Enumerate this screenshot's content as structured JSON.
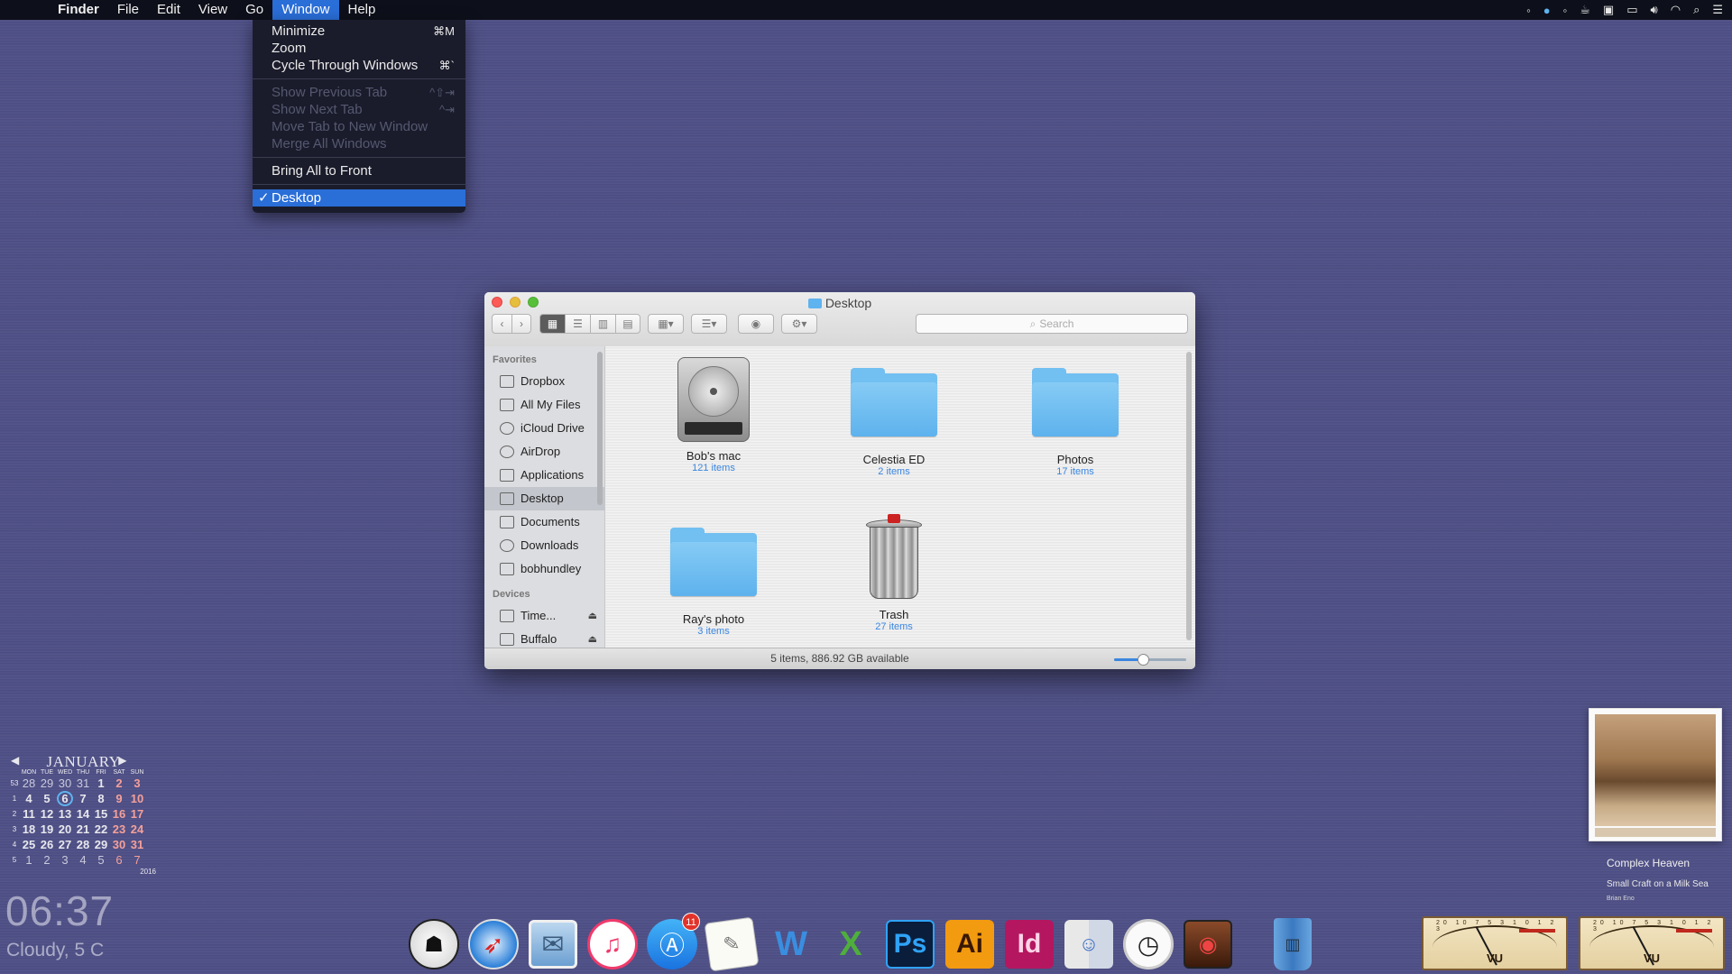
{
  "menubar": {
    "app_name": "Finder",
    "menus": [
      "File",
      "Edit",
      "View",
      "Go",
      "Window",
      "Help"
    ],
    "active_menu": "Window",
    "status_icons": [
      "dropbox-icon",
      "status-dot-icon",
      "menu-extra-icon",
      "coffee-icon",
      "terminal-icon",
      "airplay-icon",
      "volume-icon",
      "wifi-icon",
      "spotlight-icon",
      "notification-center-icon"
    ]
  },
  "window_menu": {
    "items": [
      {
        "label": "Minimize",
        "shortcut": "⌘M",
        "disabled": false
      },
      {
        "label": "Zoom",
        "shortcut": "",
        "disabled": false
      },
      {
        "label": "Cycle Through Windows",
        "shortcut": "⌘`",
        "disabled": false
      },
      {
        "label": "Show Previous Tab",
        "shortcut": "^⇧⇥",
        "disabled": true
      },
      {
        "label": "Show Next Tab",
        "shortcut": "^⇥",
        "disabled": true
      },
      {
        "label": "Move Tab to New Window",
        "shortcut": "",
        "disabled": true
      },
      {
        "label": "Merge All Windows",
        "shortcut": "",
        "disabled": true
      },
      {
        "label": "Bring All to Front",
        "shortcut": "",
        "disabled": false
      },
      {
        "label": "Desktop",
        "shortcut": "",
        "disabled": false,
        "checked": true
      }
    ]
  },
  "finder": {
    "title": "Desktop",
    "search_placeholder": "Search",
    "sidebar": {
      "favorites_header": "Favorites",
      "favorites": [
        {
          "label": "Dropbox",
          "icon": "folder-icon"
        },
        {
          "label": "All My Files",
          "icon": "all-files-icon"
        },
        {
          "label": "iCloud Drive",
          "icon": "cloud-icon"
        },
        {
          "label": "AirDrop",
          "icon": "airdrop-icon"
        },
        {
          "label": "Applications",
          "icon": "applications-icon"
        },
        {
          "label": "Desktop",
          "icon": "desktop-icon",
          "selected": true
        },
        {
          "label": "Documents",
          "icon": "documents-icon"
        },
        {
          "label": "Downloads",
          "icon": "downloads-icon"
        },
        {
          "label": "bobhundley",
          "icon": "home-icon"
        }
      ],
      "devices_header": "Devices",
      "devices": [
        {
          "label": "Time...",
          "icon": "disk-icon"
        },
        {
          "label": "Buffalo",
          "icon": "disk-icon"
        }
      ]
    },
    "items": [
      {
        "name": "Bob's mac",
        "count": "121 items",
        "kind": "hard-drive-icon"
      },
      {
        "name": "Celestia ED",
        "count": "2 items",
        "kind": "folder-icon"
      },
      {
        "name": "Photos",
        "count": "17 items",
        "kind": "folder-icon"
      },
      {
        "name": "Ray's photo",
        "count": "3 items",
        "kind": "folder-icon"
      },
      {
        "name": "Trash",
        "count": "27 items",
        "kind": "trash-icon"
      }
    ],
    "status_text": "5 items, 886.92 GB available",
    "icon_size_fraction": 0.4
  },
  "calendar": {
    "month": "JANUARY",
    "year": "2016",
    "days_of_week": [
      "MON",
      "TUE",
      "WED",
      "THU",
      "FRI",
      "SAT",
      "SUN"
    ],
    "weeks": [
      {
        "wn": "53",
        "days": [
          "28",
          "29",
          "30",
          "31",
          "1",
          "2",
          "3"
        ]
      },
      {
        "wn": "1",
        "days": [
          "4",
          "5",
          "6",
          "7",
          "8",
          "9",
          "10"
        ]
      },
      {
        "wn": "2",
        "days": [
          "11",
          "12",
          "13",
          "14",
          "15",
          "16",
          "17"
        ]
      },
      {
        "wn": "3",
        "days": [
          "18",
          "19",
          "20",
          "21",
          "22",
          "23",
          "24"
        ]
      },
      {
        "wn": "4",
        "days": [
          "25",
          "26",
          "27",
          "28",
          "29",
          "30",
          "31"
        ]
      },
      {
        "wn": "5",
        "days": [
          "1",
          "2",
          "3",
          "4",
          "5",
          "6",
          "7"
        ]
      }
    ],
    "today": "6"
  },
  "clock": {
    "time": "06:37",
    "weather": "Cloudy, 5 C"
  },
  "now_playing": {
    "track": "Complex Heaven",
    "album": "Small Craft on a Milk Sea",
    "artist": "Brian Eno"
  },
  "vu_meters": [
    {
      "label": "VU",
      "scale": "20 10 7 5 3 1 0 1 2 3"
    },
    {
      "label": "VU",
      "scale": "20 10 7 5 3 1 0 1 2 3"
    }
  ],
  "dock": {
    "apps": [
      {
        "name": "stormtrooper-icon",
        "running": true
      },
      {
        "name": "safari-icon",
        "running": true
      },
      {
        "name": "mail-icon",
        "running": true
      },
      {
        "name": "itunes-icon",
        "running": true
      },
      {
        "name": "app-store-icon",
        "badge": "11",
        "running": false
      },
      {
        "name": "textedit-icon",
        "running": false
      },
      {
        "name": "word-icon",
        "running": false
      },
      {
        "name": "scrivener-icon",
        "running": false
      },
      {
        "name": "photoshop-icon",
        "text": "Ps",
        "running": false
      },
      {
        "name": "illustrator-icon",
        "text": "Ai",
        "running": false
      },
      {
        "name": "indesign-icon",
        "text": "Id",
        "running": false
      },
      {
        "name": "finder-icon",
        "running": false
      },
      {
        "name": "clock-icon",
        "running": true
      },
      {
        "name": "radio-icon",
        "running": true
      },
      {
        "name": "trash-icon",
        "running": false
      }
    ]
  }
}
